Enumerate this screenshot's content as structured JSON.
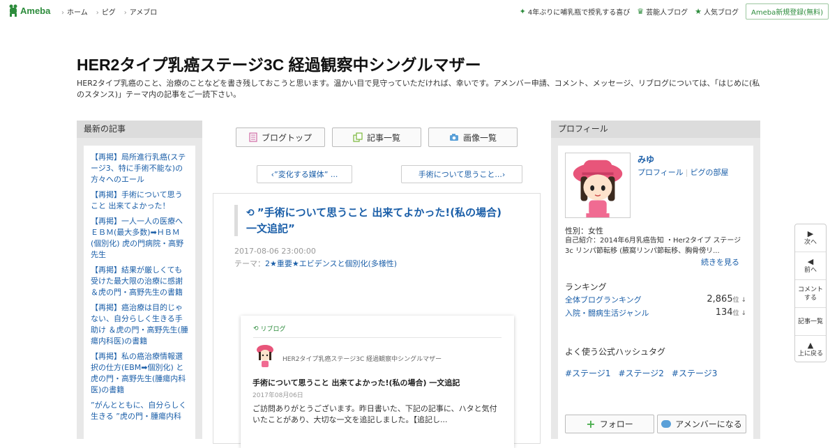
{
  "topbar": {
    "logo_text": "Ameba",
    "nav": [
      "ホーム",
      "ピグ",
      "アメブロ"
    ],
    "right_items": [
      "4年ぶりに哺乳瓶で授乳する喜び",
      "芸能人ブログ",
      "人気ブログ"
    ],
    "signup": "Ameba新規登録(無料)"
  },
  "blog": {
    "title": "HER2タイプ乳癌ステージ3C 経過観察中シングルマザー",
    "description": "HER2タイプ乳癌のこと、治療のことなどを書き残しておこうと思います。温かい目で見守っていただければ、幸いです。アメンバー申請、コメント、メッセージ、リブログについては、「はじめに(私のスタンス)」テーマ内の記事をご一読下さい。"
  },
  "left": {
    "heading": "最新の記事",
    "items": [
      "【再掲】局所進行乳癌(ステージ3、特に手術不能な)の方々へのエール",
      "【再掲】手術について思うこと 出来てよかった！",
      "【再掲】一人一人の医療へ ＥＢＭ(最大多数)➡ＨＢＭ(個別化) 虎の門病院・高野先生",
      "【再掲】結果が厳しくても受けた最大限の治療に感謝 ＆虎の門・高野先生の書籍",
      "【再掲】癌治療は目的じゃない、自分らしく生きる手助け ＆虎の門・高野先生(腫瘍内科医)の書籍",
      "【再掲】私の癌治療情報選択の仕方(EBM➡個別化) と虎の門・高野先生(腫瘍内科医)の書籍",
      "”がんとともに、自分らしく生きる ”虎の門・腫瘍内科"
    ]
  },
  "center": {
    "nav_buttons": [
      "ブログトップ",
      "記事一覧",
      "画像一覧"
    ],
    "prev_label": "”変化する媒体” ...",
    "next_label": "手術について思うこと...",
    "article": {
      "title": "”手術について思うこと 出来てよかった!(私の場合) 一文追記”",
      "date": "2017-08-06 23:00:00",
      "theme_label": "テーマ：",
      "theme": "2★重要★エビデンスと個別化(多様性)"
    },
    "reblog": {
      "label": "リブログ",
      "blog_name": "HER2タイプ乳癌ステージ3C 経過観察中シングルマザー",
      "title": "手術について思うこと 出来てよかった!(私の場合) 一文追記",
      "date": "2017年08月06日",
      "excerpt": "ご訪問ありがとうございます。昨日書いた、下記の記事に、ハタと気付いたことがあり、大切な一文を追記しました。【追記し..."
    }
  },
  "right": {
    "heading": "プロフィール",
    "name": "みゆ",
    "link_profile": "プロフィール",
    "link_pig": "ピグの部屋",
    "gender": "性別：女性",
    "intro": "自己紹介：2014年6月乳癌告知 ・Her2タイプ ステージ3c リンパ節転移 (腋窩リンパ節転移、胸骨傍リ...",
    "more": "続きを見る",
    "ranking_head": "ランキング",
    "rankings": [
      {
        "name": "全体ブログランキング",
        "value": "2,865",
        "unit": "位 ↓"
      },
      {
        "name": "入院・闘病生活ジャンル",
        "value": "134",
        "unit": "位 ↓"
      }
    ],
    "hashtag_head": "よく使う公式ハッシュタグ",
    "hashtags": [
      "#ステージ1",
      "#ステージ2",
      "#ステージ3"
    ],
    "follow": "フォロー",
    "amember": "アメンバーになる"
  },
  "sidenav": {
    "next": "次へ",
    "prev": "前へ",
    "comment": "コメントする",
    "list": "記事一覧",
    "top": "上に戻る"
  },
  "colors": {
    "brand": "#2d8c3c",
    "link": "#1a5ea8"
  }
}
